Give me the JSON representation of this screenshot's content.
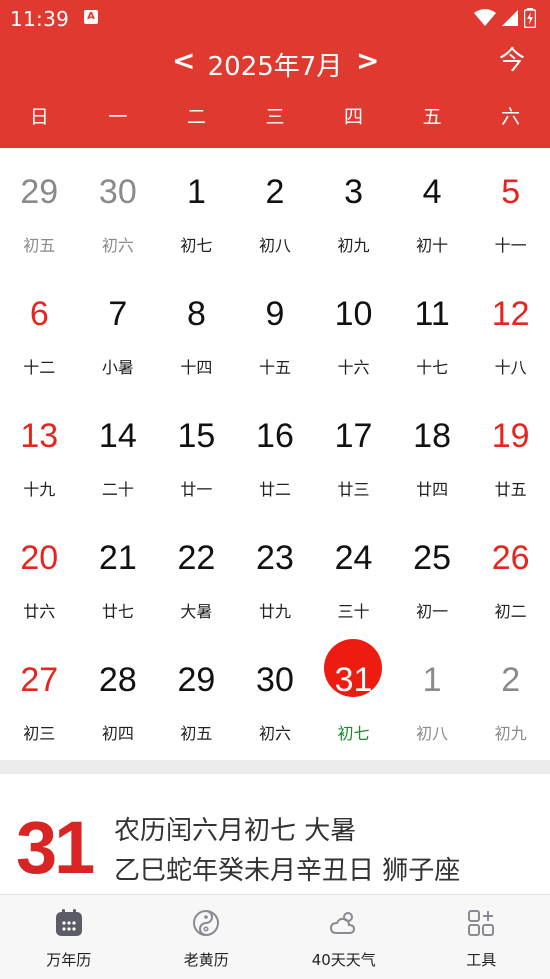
{
  "status_bar": {
    "time": "11:39",
    "notification_icon": "A"
  },
  "header": {
    "prev_label": "<",
    "month_title": "2025年7月",
    "next_label": ">",
    "today_label": "今",
    "weekdays": [
      "日",
      "一",
      "二",
      "三",
      "四",
      "五",
      "六"
    ]
  },
  "calendar": {
    "rows": [
      [
        {
          "day": "29",
          "lunar": "初五",
          "type": "other"
        },
        {
          "day": "30",
          "lunar": "初六",
          "type": "other"
        },
        {
          "day": "1",
          "lunar": "初七",
          "type": "normal"
        },
        {
          "day": "2",
          "lunar": "初八",
          "type": "normal"
        },
        {
          "day": "3",
          "lunar": "初九",
          "type": "normal"
        },
        {
          "day": "4",
          "lunar": "初十",
          "type": "normal"
        },
        {
          "day": "5",
          "lunar": "十一",
          "type": "weekend"
        }
      ],
      [
        {
          "day": "6",
          "lunar": "十二",
          "type": "weekend"
        },
        {
          "day": "7",
          "lunar": "小暑",
          "type": "normal"
        },
        {
          "day": "8",
          "lunar": "十四",
          "type": "normal"
        },
        {
          "day": "9",
          "lunar": "十五",
          "type": "normal"
        },
        {
          "day": "10",
          "lunar": "十六",
          "type": "normal"
        },
        {
          "day": "11",
          "lunar": "十七",
          "type": "normal"
        },
        {
          "day": "12",
          "lunar": "十八",
          "type": "weekend"
        }
      ],
      [
        {
          "day": "13",
          "lunar": "十九",
          "type": "weekend"
        },
        {
          "day": "14",
          "lunar": "二十",
          "type": "normal"
        },
        {
          "day": "15",
          "lunar": "廿一",
          "type": "normal"
        },
        {
          "day": "16",
          "lunar": "廿二",
          "type": "normal"
        },
        {
          "day": "17",
          "lunar": "廿三",
          "type": "normal"
        },
        {
          "day": "18",
          "lunar": "廿四",
          "type": "normal"
        },
        {
          "day": "19",
          "lunar": "廿五",
          "type": "weekend"
        }
      ],
      [
        {
          "day": "20",
          "lunar": "廿六",
          "type": "weekend"
        },
        {
          "day": "21",
          "lunar": "廿七",
          "type": "normal"
        },
        {
          "day": "22",
          "lunar": "大暑",
          "type": "normal"
        },
        {
          "day": "23",
          "lunar": "廿九",
          "type": "normal"
        },
        {
          "day": "24",
          "lunar": "三十",
          "type": "normal"
        },
        {
          "day": "25",
          "lunar": "初一",
          "type": "normal"
        },
        {
          "day": "26",
          "lunar": "初二",
          "type": "weekend"
        }
      ],
      [
        {
          "day": "27",
          "lunar": "初三",
          "type": "weekend"
        },
        {
          "day": "28",
          "lunar": "初四",
          "type": "normal"
        },
        {
          "day": "29",
          "lunar": "初五",
          "type": "normal"
        },
        {
          "day": "30",
          "lunar": "初六",
          "type": "normal"
        },
        {
          "day": "31",
          "lunar": "初七",
          "type": "today"
        },
        {
          "day": "1",
          "lunar": "初八",
          "type": "other"
        },
        {
          "day": "2",
          "lunar": "初九",
          "type": "other"
        }
      ]
    ]
  },
  "detail": {
    "big_day": "31",
    "line1": "农历闰六月初七 大暑",
    "line2": "乙巳蛇年癸未月辛丑日  狮子座"
  },
  "tabs": [
    {
      "label": "万年历",
      "icon": "calendar-icon",
      "active": true
    },
    {
      "label": "老黄历",
      "icon": "yinyang-icon",
      "active": false
    },
    {
      "label": "40天天气",
      "icon": "weather-icon",
      "active": false
    },
    {
      "label": "工具",
      "icon": "tools-icon",
      "active": false
    }
  ],
  "colors": {
    "header_red": "#e03a30",
    "weekend_red": "#e8241f",
    "today_circle": "#ee1c10",
    "today_lunar_green": "#1a8a2a",
    "big_day_red": "#d92424"
  }
}
